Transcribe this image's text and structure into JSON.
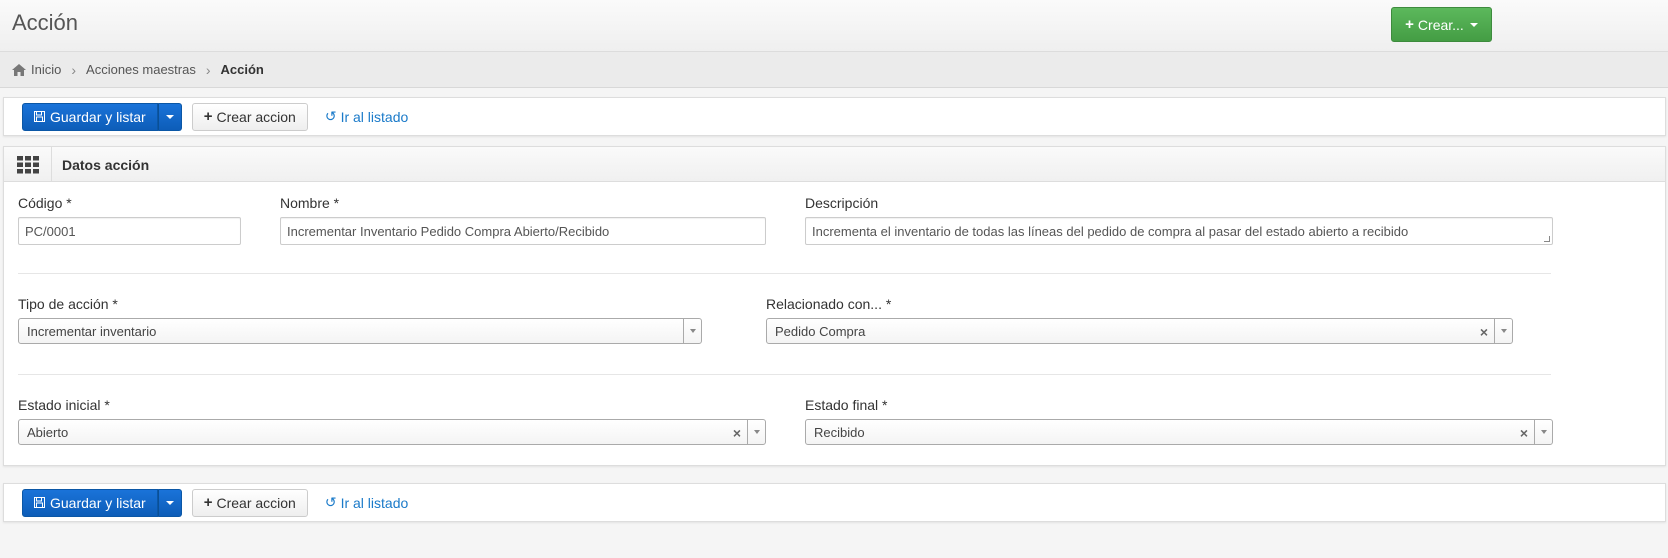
{
  "header": {
    "title": "Acción",
    "create_button": "Crear..."
  },
  "breadcrumb": {
    "items": [
      "Inicio",
      "Acciones maestras"
    ],
    "current": "Acción"
  },
  "toolbar": {
    "save_label": "Guardar y listar",
    "create_label": "Crear accion",
    "list_label": "Ir al listado"
  },
  "panel": {
    "title": "Datos acción",
    "fields": {
      "codigo": {
        "label": "Código *",
        "value": "PC/0001"
      },
      "nombre": {
        "label": "Nombre *",
        "value": "Incrementar Inventario Pedido Compra Abierto/Recibido"
      },
      "descripcion": {
        "label": "Descripción",
        "value": "Incrementa el inventario de todas las líneas del pedido de compra al pasar del estado abierto a recibido"
      },
      "tipo_accion": {
        "label": "Tipo de acción *",
        "value": "Incrementar inventario"
      },
      "relacionado": {
        "label": "Relacionado con... *",
        "value": "Pedido Compra"
      },
      "estado_inicial": {
        "label": "Estado inicial *",
        "value": "Abierto"
      },
      "estado_final": {
        "label": "Estado final *",
        "value": "Recibido"
      }
    }
  },
  "colors": {
    "primary": "#0d5db8",
    "success": "#449d44",
    "link": "#1a7ac9"
  },
  "icons": {
    "home": "home-icon",
    "save": "save-icon",
    "plus": "plus-icon",
    "undo": "undo-icon",
    "grid": "grid-icon"
  }
}
